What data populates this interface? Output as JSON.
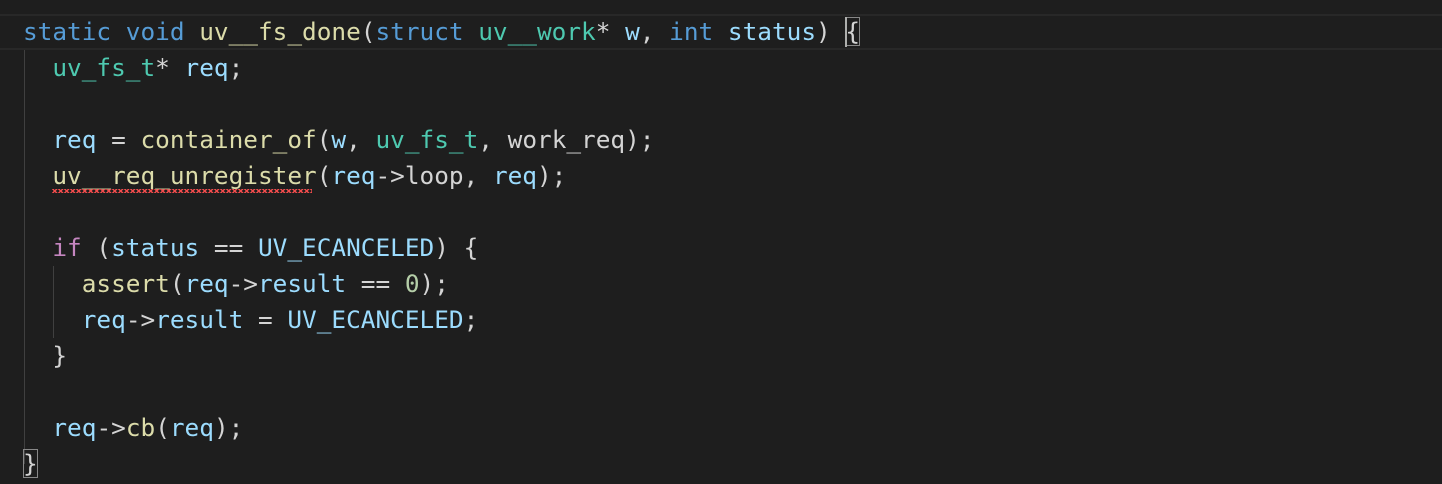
{
  "editor": {
    "lines": [
      [
        {
          "t": "static",
          "c": "kw"
        },
        {
          "t": " ",
          "c": ""
        },
        {
          "t": "void",
          "c": "kw"
        },
        {
          "t": " ",
          "c": ""
        },
        {
          "t": "uv__fs_done",
          "c": "fn"
        },
        {
          "t": "(",
          "c": ""
        },
        {
          "t": "struct",
          "c": "kw"
        },
        {
          "t": " ",
          "c": ""
        },
        {
          "t": "uv__work",
          "c": "ty"
        },
        {
          "t": "* ",
          "c": ""
        },
        {
          "t": "w",
          "c": "var"
        },
        {
          "t": ", ",
          "c": ""
        },
        {
          "t": "int",
          "c": "kw"
        },
        {
          "t": " ",
          "c": ""
        },
        {
          "t": "status",
          "c": "var"
        },
        {
          "t": ") ",
          "c": ""
        },
        {
          "t": "{",
          "c": "bracket"
        }
      ],
      [
        {
          "t": "  ",
          "c": ""
        },
        {
          "t": "uv_fs_t",
          "c": "ty"
        },
        {
          "t": "* ",
          "c": ""
        },
        {
          "t": "req",
          "c": "var"
        },
        {
          "t": ";",
          "c": ""
        }
      ],
      [],
      [
        {
          "t": "  ",
          "c": ""
        },
        {
          "t": "req",
          "c": "var"
        },
        {
          "t": " = ",
          "c": ""
        },
        {
          "t": "container_of",
          "c": "fn"
        },
        {
          "t": "(",
          "c": ""
        },
        {
          "t": "w",
          "c": "var"
        },
        {
          "t": ", ",
          "c": ""
        },
        {
          "t": "uv_fs_t",
          "c": "ty"
        },
        {
          "t": ", work_req);",
          "c": ""
        }
      ],
      [
        {
          "t": "  ",
          "c": ""
        },
        {
          "t": "uv__req_unregister",
          "c": "fn"
        },
        {
          "t": "(",
          "c": ""
        },
        {
          "t": "req",
          "c": "var"
        },
        {
          "t": "->loop, ",
          "c": ""
        },
        {
          "t": "req",
          "c": "var"
        },
        {
          "t": ");",
          "c": ""
        }
      ],
      [],
      [
        {
          "t": "  ",
          "c": ""
        },
        {
          "t": "if",
          "c": "ctl"
        },
        {
          "t": " (",
          "c": ""
        },
        {
          "t": "status",
          "c": "var"
        },
        {
          "t": " == ",
          "c": ""
        },
        {
          "t": "UV_ECANCELED",
          "c": "var"
        },
        {
          "t": ") {",
          "c": ""
        }
      ],
      [
        {
          "t": "    ",
          "c": ""
        },
        {
          "t": "assert",
          "c": "fn"
        },
        {
          "t": "(",
          "c": ""
        },
        {
          "t": "req",
          "c": "var"
        },
        {
          "t": "->",
          "c": ""
        },
        {
          "t": "result",
          "c": "var"
        },
        {
          "t": " == ",
          "c": ""
        },
        {
          "t": "0",
          "c": "num"
        },
        {
          "t": ");",
          "c": ""
        }
      ],
      [
        {
          "t": "    ",
          "c": ""
        },
        {
          "t": "req",
          "c": "var"
        },
        {
          "t": "->",
          "c": ""
        },
        {
          "t": "result",
          "c": "var"
        },
        {
          "t": " = ",
          "c": ""
        },
        {
          "t": "UV_ECANCELED",
          "c": "var"
        },
        {
          "t": ";",
          "c": ""
        }
      ],
      [
        {
          "t": "  }",
          "c": ""
        }
      ],
      [],
      [
        {
          "t": "  ",
          "c": ""
        },
        {
          "t": "req",
          "c": "var"
        },
        {
          "t": "->",
          "c": ""
        },
        {
          "t": "cb",
          "c": "fn"
        },
        {
          "t": "(",
          "c": ""
        },
        {
          "t": "req",
          "c": "var"
        },
        {
          "t": ");",
          "c": ""
        }
      ],
      [
        {
          "t": "}",
          "c": "bracket"
        }
      ]
    ],
    "colors": {
      "background": "#1e1e1e",
      "keyword": "#569cd6",
      "control": "#c586c0",
      "function": "#dcdcaa",
      "type": "#4ec9b0",
      "variable": "#9cdcfe",
      "number": "#b5cea8",
      "error_squiggle": "#f14c4c"
    }
  }
}
